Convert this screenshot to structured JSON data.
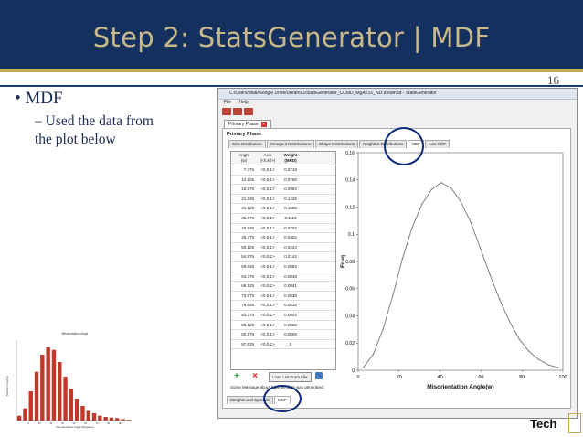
{
  "slide": {
    "title": "Step 2: StatsGenerator | MDF",
    "page_number": "16",
    "bullet": "MDF",
    "sub_bullet": "Used the data from the plot below",
    "logo_text": "Tech"
  },
  "app": {
    "window_title": "C:/Users/Matt/Google Drive/DreamID/StatsGenerator_CCMD_MgAZ31_ND.dream3d - StatsGenerator",
    "menu": [
      "File",
      "Help"
    ],
    "doc_tab": "Primary Phase",
    "phase_label": "Primary Phase",
    "tabs": [
      "Size Distribution",
      "Omega 3 Distributions",
      "Shape Distributions",
      "Neighbor Distributions",
      "ODF",
      "Axis ODF"
    ],
    "table": {
      "headers": [
        [
          "Angle",
          "(w)"
        ],
        [
          "Axis",
          "(<h,k,l>)"
        ],
        [
          "Weight",
          "(MRD)"
        ]
      ],
      "rows": [
        [
          "7.375",
          "<0,0,1>",
          "0.0718"
        ],
        [
          "12.125",
          "<0,0,1>",
          "0.0768"
        ],
        [
          "16.875",
          "<0,0,1>",
          "0.0984"
        ],
        [
          "21.625",
          "<0,0,1>",
          "0.1226"
        ],
        [
          "31.125",
          "<0,0,1>",
          "0.1688"
        ],
        [
          "35.875",
          "<0,0,1>",
          "0.1113"
        ],
        [
          "40.625",
          "<0,0,1>",
          "0.0703"
        ],
        [
          "45.375",
          "<0,0,1>",
          "0.0402"
        ],
        [
          "50.125",
          "<0,0,1>",
          "0.0224"
        ],
        [
          "54.875",
          "<0,0,1>",
          "0.0142"
        ],
        [
          "59.625",
          "<0,0,1>",
          "0.0083"
        ],
        [
          "64.375",
          "<0,0,1>",
          "0.0048"
        ],
        [
          "69.125",
          "<0,0,1>",
          "0.0041"
        ],
        [
          "73.875",
          "<0,0,1>",
          "0.0038"
        ],
        [
          "78.625",
          "<0,0,1>",
          "0.0035"
        ],
        [
          "83.375",
          "<0,0,1>",
          "0.0044"
        ],
        [
          "88.125",
          "<0,0,1>",
          "0.0068"
        ],
        [
          "92.875",
          "<0,0,1>",
          "0.0009"
        ],
        [
          "97.625",
          "<0,0,1>",
          "0"
        ]
      ]
    },
    "load_button": "Load List From File",
    "message": "Some Message about how the data was generated.",
    "bottom_tabs": [
      "Weights and Spreads",
      "MDF"
    ],
    "colors": {
      "curve": "#666666",
      "highlight": "#0a2a7a",
      "mini_bar": "#c0392b"
    }
  },
  "chart_data": [
    {
      "type": "line",
      "xlabel": "Misorientation Angle(w)",
      "ylabel": "Freq",
      "xlim": [
        0,
        100
      ],
      "ylim": [
        0,
        0.16
      ],
      "xticks": [
        "0",
        "20",
        "40",
        "60",
        "80",
        "100"
      ],
      "yticks": [
        "0",
        "0.02",
        "0.04",
        "0.06",
        "0.08",
        "0.1",
        "0.12",
        "0.14",
        "0.16"
      ],
      "x": [
        2.5,
        7.4,
        12.1,
        16.9,
        21.6,
        26.4,
        31.1,
        35.9,
        40.6,
        45.4,
        50.1,
        54.9,
        59.6,
        64.4,
        69.1,
        73.9,
        78.6,
        83.4,
        88.1,
        92.9,
        97.6
      ],
      "values": [
        0.002,
        0.012,
        0.03,
        0.055,
        0.082,
        0.105,
        0.122,
        0.133,
        0.138,
        0.134,
        0.124,
        0.109,
        0.09,
        0.07,
        0.052,
        0.036,
        0.023,
        0.014,
        0.008,
        0.004,
        0.002
      ]
    },
    {
      "type": "bar",
      "title": "Misorientation Angle",
      "xlabel": "Misorientation Angle (Degrees)",
      "ylabel": "Number Fraction",
      "xticks": [
        "10",
        "20",
        "30",
        "40",
        "50",
        "60",
        "70",
        "80",
        "90"
      ],
      "x": [
        2.5,
        7.5,
        12.5,
        17.5,
        22.5,
        27.5,
        32.5,
        37.5,
        42.5,
        47.5,
        52.5,
        57.5,
        62.5,
        67.5,
        72.5,
        77.5,
        82.5,
        87.5,
        92.5,
        97.5
      ],
      "values": [
        0.02,
        0.05,
        0.12,
        0.2,
        0.27,
        0.3,
        0.29,
        0.24,
        0.18,
        0.13,
        0.09,
        0.06,
        0.04,
        0.03,
        0.02,
        0.015,
        0.012,
        0.01,
        0.006,
        0.003
      ]
    }
  ]
}
